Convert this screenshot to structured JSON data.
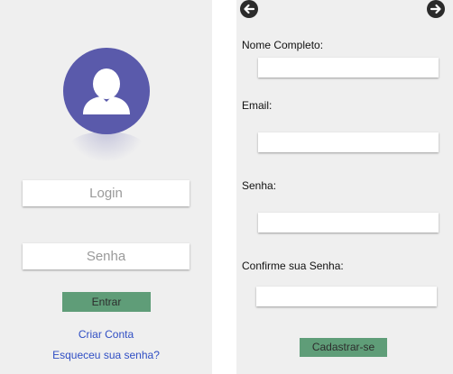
{
  "login": {
    "login_placeholder": "Login",
    "senha_placeholder": "Senha",
    "entrar_label": "Entrar",
    "criar_conta_link": "Criar Conta",
    "esqueceu_link": "Esqueceu sua senha?"
  },
  "register": {
    "nome_label": "Nome Completo:",
    "email_label": "Email:",
    "senha_label": "Senha:",
    "confirme_label": "Confirme sua Senha:",
    "nome_value": "",
    "email_value": "",
    "senha_value": "",
    "confirme_value": "",
    "cadastrar_label": "Cadastrar-se"
  },
  "icons": {
    "back": "arrow-left-circle",
    "forward": "arrow-right-circle"
  },
  "colors": {
    "avatar": "#5a5aab",
    "button": "#5f9d78",
    "link": "#2f4ec4",
    "background": "#efefef"
  }
}
